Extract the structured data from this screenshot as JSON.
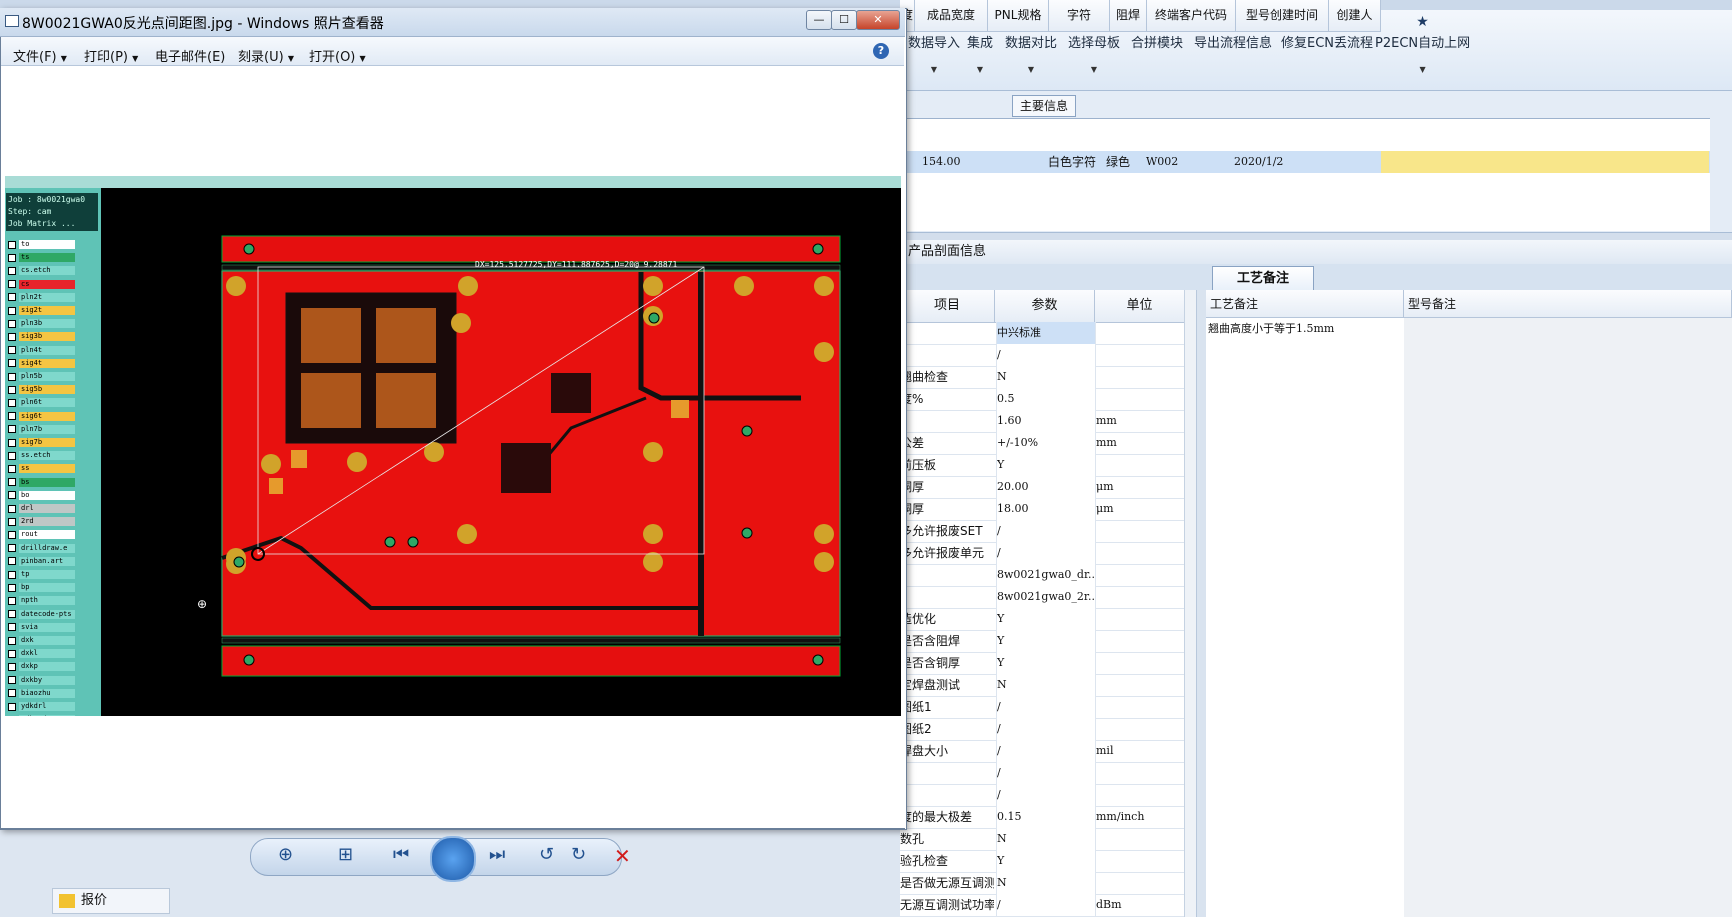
{
  "viewer": {
    "title": "8W0021GWA0反光点间距图.jpg - Windows 照片查看器",
    "menu": [
      "文件(F)",
      "打印(P)",
      "电子邮件(E)",
      "刻录(U)",
      "打开(O)"
    ],
    "window_buttons": {
      "min": "—",
      "max": "☐",
      "close": "✕"
    },
    "help": "?"
  },
  "cam_image": {
    "info": [
      "Job : 8w0021gwa0",
      "Step: cam",
      "Job Matrix ..."
    ],
    "layers": [
      {
        "name": "to",
        "color": "#ffffff"
      },
      {
        "name": "ts",
        "color": "#2fa866"
      },
      {
        "name": "cs.etch",
        "color": "#7fd8cc"
      },
      {
        "name": "cs",
        "color": "#e8242b"
      },
      {
        "name": "pln2t",
        "color": "#7fd8cc"
      },
      {
        "name": "sig2t",
        "color": "#f4c542"
      },
      {
        "name": "pln3b",
        "color": "#7fd8cc"
      },
      {
        "name": "sig3b",
        "color": "#f4c542"
      },
      {
        "name": "pln4t",
        "color": "#7fd8cc"
      },
      {
        "name": "sig4t",
        "color": "#f4c542"
      },
      {
        "name": "pln5b",
        "color": "#7fd8cc"
      },
      {
        "name": "sig5b",
        "color": "#f4c542"
      },
      {
        "name": "pln6t",
        "color": "#7fd8cc"
      },
      {
        "name": "sig6t",
        "color": "#f4c542"
      },
      {
        "name": "pln7b",
        "color": "#7fd8cc"
      },
      {
        "name": "sig7b",
        "color": "#f4c542"
      },
      {
        "name": "ss.etch",
        "color": "#7fd8cc"
      },
      {
        "name": "ss",
        "color": "#f4c542"
      },
      {
        "name": "bs",
        "color": "#2fa866"
      },
      {
        "name": "bo",
        "color": "#ffffff"
      },
      {
        "name": "drl",
        "color": "#bfc7c6"
      },
      {
        "name": "2rd",
        "color": "#bfc7c6"
      },
      {
        "name": "rout",
        "color": "#ffffff"
      },
      {
        "name": "drilldraw.e",
        "color": "#7fd8cc"
      },
      {
        "name": "pinban.art",
        "color": "#7fd8cc"
      },
      {
        "name": "tp",
        "color": "#7fd8cc"
      },
      {
        "name": "bp",
        "color": "#7fd8cc"
      },
      {
        "name": "npth",
        "color": "#7fd8cc"
      },
      {
        "name": "datecode-pts",
        "color": "#7fd8cc"
      },
      {
        "name": "svia",
        "color": "#7fd8cc"
      },
      {
        "name": "dxk",
        "color": "#7fd8cc"
      },
      {
        "name": "dxkl",
        "color": "#7fd8cc"
      },
      {
        "name": "dxkp",
        "color": "#7fd8cc"
      },
      {
        "name": "dxkby",
        "color": "#7fd8cc"
      },
      {
        "name": "biaozhu",
        "color": "#7fd8cc"
      },
      {
        "name": "ydkdrl",
        "color": "#7fd8cc"
      },
      {
        "name": "ydk2rd",
        "color": "#7fd8cc"
      },
      {
        "name": "clamp_area",
        "color": "#7fd8cc"
      },
      {
        "name": "ss_clampline",
        "color": "#7fd8cc"
      },
      {
        "name": "d",
        "color": "#7fd8cc"
      }
    ],
    "measure_text": "DX=125.5127725,DY=111.887625,D=20@ 9.28871"
  },
  "ribbon": {
    "buttons": [
      {
        "label": "数据导入",
        "icon": "➤"
      },
      {
        "label": "集成",
        "icon": "⬇"
      },
      {
        "label": "数据对比",
        "icon": "✎"
      },
      {
        "label": "选择母板",
        "icon": "⇄"
      },
      {
        "label": "合拼模块",
        "icon": "☰"
      },
      {
        "label": "导出流程信息",
        "icon": "☺"
      },
      {
        "label": "修复ECN丢流程",
        "icon": "✐"
      },
      {
        "label": "P2ECN自动上网",
        "icon": "★"
      }
    ],
    "dropdown_arrow": "▼"
  },
  "main_info": {
    "tab": "主要信息",
    "columns": [
      "度",
      "成品宽度",
      "PNL规格",
      "字符",
      "阻焊",
      "终端客户代码",
      "型号创建时间",
      "创建人"
    ],
    "row": [
      "",
      "154.00",
      "",
      "白色字符",
      "绿色",
      "W002",
      "2020/1/2",
      ""
    ]
  },
  "section_title": "产品剖面信息",
  "process_tab": "工艺备注",
  "param_table": {
    "headers": [
      "项目",
      "参数",
      "单位"
    ],
    "rows": [
      {
        "item": "",
        "value": "中兴标准",
        "unit": ""
      },
      {
        "item": "",
        "value": "/",
        "unit": ""
      },
      {
        "item": "翘曲检查",
        "value": "N",
        "unit": ""
      },
      {
        "item": "度%",
        "value": "0.5",
        "unit": ""
      },
      {
        "item": "",
        "value": "1.60",
        "unit": "mm"
      },
      {
        "item": "公差",
        "value": "+/-10%",
        "unit": "mm"
      },
      {
        "item": "前压板",
        "value": "Y",
        "unit": ""
      },
      {
        "item": "铜厚",
        "value": "20.00",
        "unit": "μm"
      },
      {
        "item": "铜厚",
        "value": "18.00",
        "unit": "μm"
      },
      {
        "item": "多允许报废SET",
        "value": "/",
        "unit": ""
      },
      {
        "item": "多允许报废单元",
        "value": "/",
        "unit": ""
      },
      {
        "item": "",
        "value": "8w0021gwa0_dr...",
        "unit": ""
      },
      {
        "item": "",
        "value": "8w0021gwa0_2r...",
        "unit": ""
      },
      {
        "item": "造优化",
        "value": "Y",
        "unit": ""
      },
      {
        "item": "是否含阻焊",
        "value": "Y",
        "unit": ""
      },
      {
        "item": "是否含铜厚",
        "value": "Y",
        "unit": ""
      },
      {
        "item": "定焊盘测试",
        "value": "N",
        "unit": ""
      },
      {
        "item": "图纸1",
        "value": "/",
        "unit": ""
      },
      {
        "item": "图纸2",
        "value": "/",
        "unit": ""
      },
      {
        "item": "焊盘大小",
        "value": "/",
        "unit": "mil"
      },
      {
        "item": "",
        "value": "/",
        "unit": ""
      },
      {
        "item": "",
        "value": "/",
        "unit": ""
      },
      {
        "item": "度的最大极差",
        "value": "0.15",
        "unit": "mm/inch"
      },
      {
        "item": "数孔",
        "value": "N",
        "unit": ""
      },
      {
        "item": "验孔检查",
        "value": "Y",
        "unit": ""
      },
      {
        "item": "是否做无源互调测试",
        "value": "N",
        "unit": ""
      },
      {
        "item": "无源互调测试功率",
        "value": "/",
        "unit": "dBm"
      }
    ]
  },
  "notes": {
    "headers": [
      "工艺备注",
      "型号备注"
    ],
    "process_note": "翘曲高度小于等于1.5mm"
  },
  "bottom_left": {
    "quote_label": "报价"
  }
}
